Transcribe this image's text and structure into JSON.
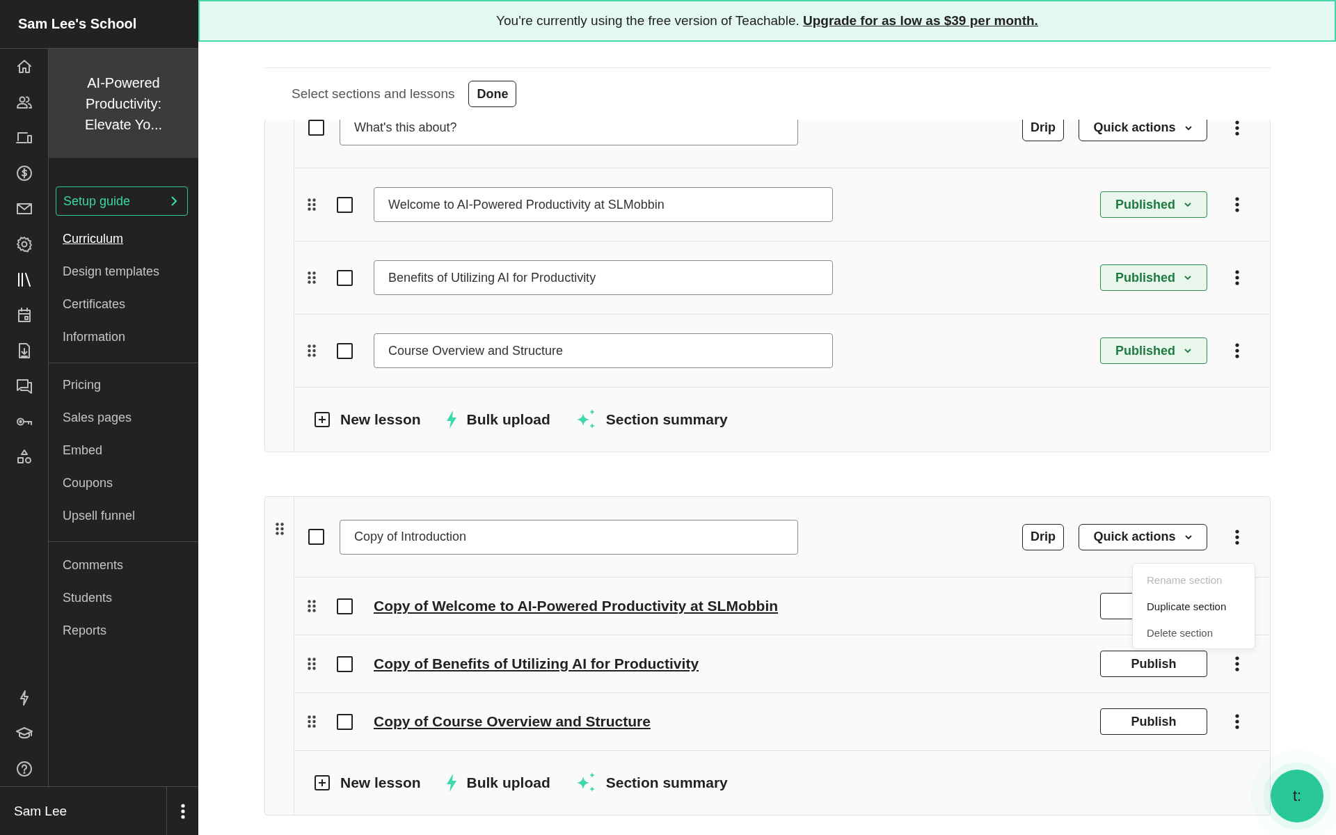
{
  "sidebar": {
    "school_name": "Sam Lee's School",
    "rail_icons": [
      {
        "kind": "home",
        "selected": false
      },
      {
        "kind": "users",
        "selected": false
      },
      {
        "kind": "devices",
        "selected": false
      },
      {
        "kind": "dollar",
        "selected": false
      },
      {
        "kind": "mail",
        "selected": false
      },
      {
        "kind": "gear",
        "selected": false
      },
      {
        "kind": "library",
        "selected": true
      },
      {
        "kind": "calendar",
        "selected": false
      },
      {
        "kind": "download",
        "selected": false
      },
      {
        "kind": "chat",
        "selected": false
      },
      {
        "kind": "key",
        "selected": false
      },
      {
        "kind": "shapes",
        "selected": false
      }
    ],
    "rail_bottom_icons": [
      {
        "kind": "bolt",
        "selected": false
      },
      {
        "kind": "cap",
        "selected": false
      },
      {
        "kind": "help",
        "selected": false
      }
    ],
    "course_title": "AI-Powered Productivity: Elevate Yo...",
    "setup_guide": "Setup guide",
    "nav_groups": [
      [
        {
          "label": "Curriculum",
          "selected": true
        },
        {
          "label": "Design templates",
          "selected": false
        },
        {
          "label": "Certificates",
          "selected": false
        },
        {
          "label": "Information",
          "selected": false
        }
      ],
      [
        {
          "label": "Pricing",
          "selected": false
        },
        {
          "label": "Sales pages",
          "selected": false
        },
        {
          "label": "Embed",
          "selected": false
        },
        {
          "label": "Coupons",
          "selected": false
        },
        {
          "label": "Upsell funnel",
          "selected": false
        }
      ],
      [
        {
          "label": "Comments",
          "selected": false
        },
        {
          "label": "Students",
          "selected": false
        },
        {
          "label": "Reports",
          "selected": false
        }
      ]
    ],
    "user": "Sam Lee"
  },
  "banner": {
    "text": "You're currently using the free version of Teachable.",
    "link": "Upgrade for as low as $39 per month."
  },
  "toolbar": {
    "label": "Select sections and lessons",
    "done": "Done"
  },
  "sections": [
    {
      "title": "What's this about?",
      "handle": false,
      "checked": false,
      "drip": "Drip",
      "quick_actions": "Quick actions",
      "lessons": [
        {
          "kind": "field",
          "title": "Welcome to AI-Powered Productivity at SLMobbin",
          "checked": false,
          "published": true,
          "button": "Published"
        },
        {
          "kind": "field",
          "title": "Benefits of Utilizing AI for Productivity",
          "checked": false,
          "published": true,
          "button": "Published"
        },
        {
          "kind": "field",
          "title": "Course Overview and Structure",
          "checked": false,
          "published": true,
          "button": "Published"
        }
      ],
      "actions": [
        {
          "kind": "plus",
          "label": "New lesson"
        },
        {
          "kind": "bolt",
          "label": "Bulk upload"
        },
        {
          "kind": "sparkle",
          "label": "Section summary"
        }
      ]
    },
    {
      "title": "Copy of Introduction",
      "handle": true,
      "checked": false,
      "drip": "Drip",
      "quick_actions": "Quick actions",
      "menu": [
        {
          "label": "Rename section",
          "disabled": true,
          "selected": false
        },
        {
          "label": "Duplicate section",
          "disabled": false,
          "selected": true
        },
        {
          "label": "Delete section",
          "disabled": false,
          "selected": false
        }
      ],
      "lessons": [
        {
          "kind": "link",
          "title": "Copy of Welcome to AI-Powered Productivity at SLMobbin",
          "checked": false,
          "published": false
        },
        {
          "kind": "link",
          "title": "Copy of Benefits of Utilizing AI for Productivity",
          "checked": false,
          "published": false,
          "button": "Publish"
        },
        {
          "kind": "link",
          "title": "Copy of Course Overview and Structure",
          "checked": false,
          "published": false,
          "button": "Publish"
        }
      ],
      "actions": [
        {
          "kind": "plus",
          "label": "New lesson"
        },
        {
          "kind": "bolt",
          "label": "Bulk upload"
        },
        {
          "kind": "sparkle",
          "label": "Section summary"
        }
      ]
    }
  ],
  "chat_button": "t:"
}
